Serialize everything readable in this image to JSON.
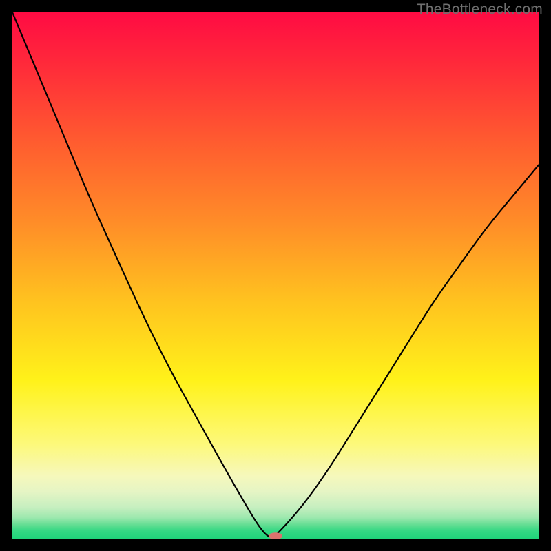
{
  "watermark": "TheBottleneck.com",
  "colors": {
    "gradient_top": "#ff0b43",
    "gradient_mid": "#fff21a",
    "gradient_bottom": "#1fd37a",
    "curve": "#000000",
    "dot": "#db726e",
    "frame": "#000000"
  },
  "chart_data": {
    "type": "line",
    "title": "",
    "xlabel": "",
    "ylabel": "",
    "xlim": [
      0,
      100
    ],
    "ylim": [
      0,
      100
    ],
    "grid": false,
    "legend": false,
    "minimum": {
      "x": 49,
      "y": 0
    },
    "annotations": [
      {
        "type": "dot",
        "x": 50,
        "y": 0.5
      }
    ],
    "series": [
      {
        "name": "bottleneck-curve",
        "x": [
          0,
          5,
          10,
          15,
          20,
          25,
          30,
          35,
          40,
          44,
          47,
          49,
          50,
          55,
          60,
          65,
          70,
          75,
          80,
          85,
          90,
          95,
          100
        ],
        "values": [
          100,
          88,
          76,
          64,
          53,
          42,
          32,
          23,
          14,
          7,
          2,
          0,
          0.5,
          6,
          13,
          21,
          29,
          37,
          45,
          52,
          59,
          65,
          71
        ]
      }
    ]
  }
}
